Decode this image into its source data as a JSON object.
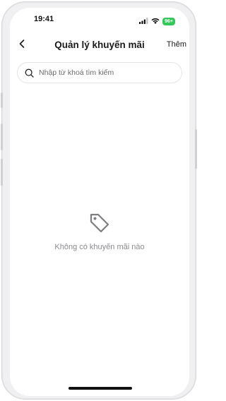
{
  "status_bar": {
    "time": "19:41",
    "battery": "96+",
    "icons": [
      "signal-icon",
      "wifi-icon",
      "battery-icon"
    ]
  },
  "header": {
    "back_icon": "chevron-left-icon",
    "title": "Quản lý khuyến mãi",
    "action_label": "Thêm"
  },
  "search": {
    "icon": "search-icon",
    "placeholder": "Nhập từ khoá tìm kiếm",
    "value": ""
  },
  "empty_state": {
    "icon": "tag-icon",
    "message": "Không có khuyến mãi nào"
  },
  "colors": {
    "battery": "#34c759",
    "muted_text": "#8a8a8f",
    "icon_gray": "#7d7d82"
  }
}
